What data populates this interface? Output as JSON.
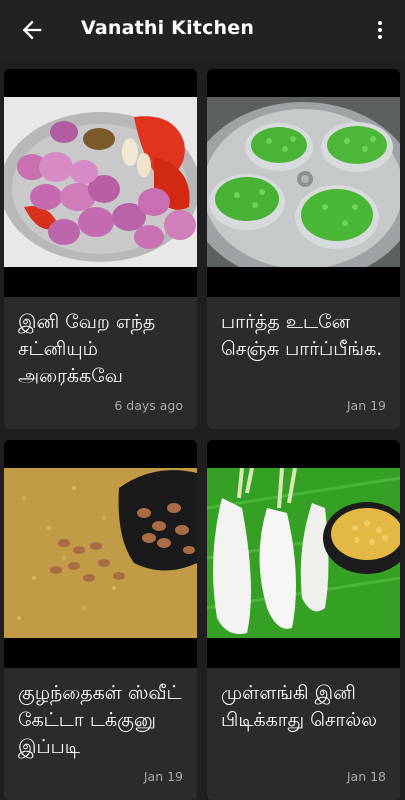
{
  "app_bar": {
    "title": "Vanathi Kitchen",
    "back_icon": "arrow-back-icon",
    "menu_icon": "more-vert-icon"
  },
  "cards": [
    {
      "title": "இனி வேற எந்த சட்னியும் அரைக்கவே",
      "date": "6 days ago"
    },
    {
      "title": "பார்த்த உடனே செஞ்சு பார்ப்பீங்க.",
      "date": "Jan 19"
    },
    {
      "title": "குழந்தைகள் ஸ்வீட் கேட்டா டக்குனு இப்படி",
      "date": "Jan 19"
    },
    {
      "title": "முள்ளங்கி இனி பிடிக்காது சொல்ல",
      "date": "Jan 18"
    }
  ],
  "colors": {
    "background": "#1f1f1f",
    "card": "#2b2b2b",
    "date_text": "#a9a9a9"
  }
}
